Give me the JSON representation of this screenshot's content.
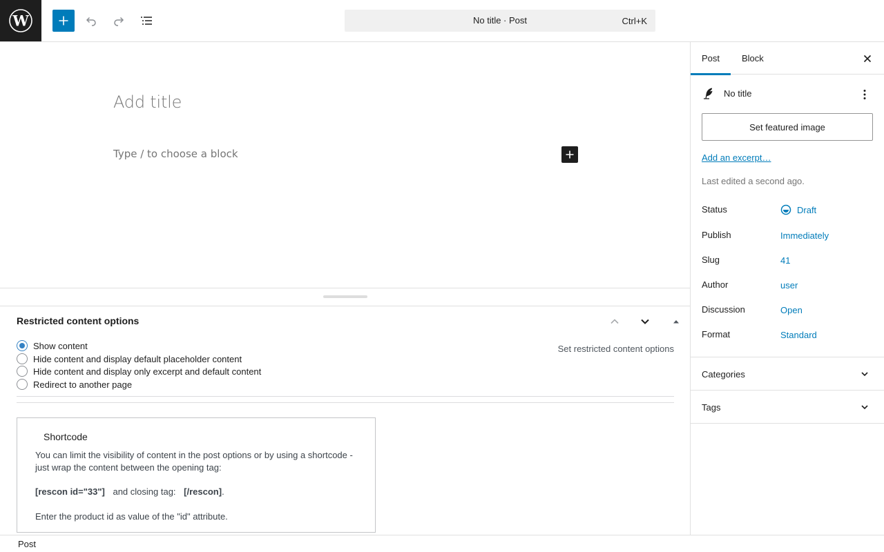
{
  "header": {
    "logo_icon": "wordpress-logo-icon",
    "inserter_icon": "plus-icon",
    "undo_icon": "undo-icon",
    "redo_icon": "redo-icon",
    "outline_icon": "list-view-icon",
    "command_title": "No title · Post",
    "command_shortcut": "Ctrl+K"
  },
  "editor": {
    "title_placeholder": "Add title",
    "block_placeholder": "Type / to choose a block"
  },
  "metabox": {
    "title": "Restricted content options",
    "hint": "Set restricted content options",
    "options": [
      {
        "label": "Show content",
        "checked": true
      },
      {
        "label": "Hide content and display default placeholder content",
        "checked": false
      },
      {
        "label": "Hide content and display only excerpt and default content",
        "checked": false
      },
      {
        "label": "Redirect to another page",
        "checked": false
      }
    ],
    "shortcode": {
      "title": "Shortcode",
      "description": "You can limit the visibility of content in the post options or by using a shortcode - just wrap the content between the opening tag:",
      "open_tag": "[rescon id=\"33\"]",
      "middle": "and closing tag:",
      "close_tag": "[/rescon]",
      "end": ".",
      "note": "Enter the product id as value of the \"id\" attribute."
    }
  },
  "footer": {
    "breadcrumb": "Post"
  },
  "sidebar": {
    "tabs": [
      "Post",
      "Block"
    ],
    "active_tab": "Post",
    "post_name": "No title",
    "featured_image_label": "Set featured image",
    "excerpt_link": "Add an excerpt…",
    "last_edited": "Last edited a second ago.",
    "rows": [
      {
        "label": "Status",
        "value": "Draft"
      },
      {
        "label": "Publish",
        "value": "Immediately"
      },
      {
        "label": "Slug",
        "value": "41"
      },
      {
        "label": "Author",
        "value": "user"
      },
      {
        "label": "Discussion",
        "value": "Open"
      },
      {
        "label": "Format",
        "value": "Standard"
      }
    ],
    "panels": [
      "Categories",
      "Tags"
    ]
  },
  "colors": {
    "accent": "#007cba",
    "dark": "#1e1e1e",
    "muted": "#757575"
  }
}
